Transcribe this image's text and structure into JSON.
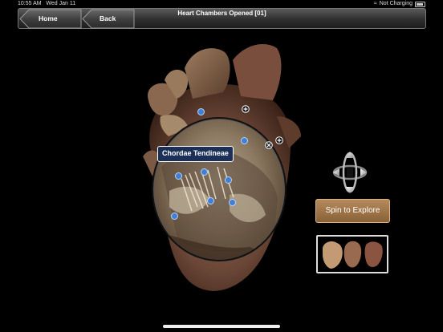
{
  "status": {
    "time": "10:55 AM",
    "date": "Wed Jan 11",
    "charging": "Not Charging"
  },
  "navbar": {
    "title": "Heart Chambers Opened [01]",
    "home_label": "Home",
    "back_label": "Back"
  },
  "lens": {
    "label": "Chordae Tendineae"
  },
  "controls": {
    "spin_label": "Spin to Explore"
  },
  "colors": {
    "label_bg": "#1c2f57",
    "spin_button": "#9c7246",
    "pin": "#3f7fd6",
    "navbar": "#3a3a3a"
  },
  "icons": [
    "wifi-icon",
    "battery-icon",
    "home-arrow-icon",
    "back-arrow-icon",
    "plus-icon",
    "close-icon",
    "rotate-arrows-icon"
  ]
}
